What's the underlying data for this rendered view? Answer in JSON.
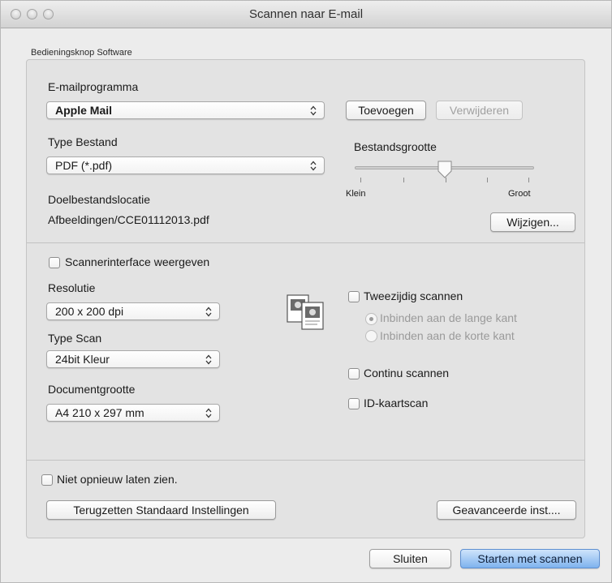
{
  "window": {
    "title": "Scannen naar E-mail"
  },
  "group": {
    "legend": "Bedieningsknop Software"
  },
  "email": {
    "label": "E-mailprogramma",
    "value": "Apple Mail",
    "add_button": "Toevoegen",
    "remove_button": "Verwijderen"
  },
  "file_type": {
    "label": "Type Bestand",
    "value": "PDF (*.pdf)"
  },
  "file_size": {
    "label": "Bestandsgrootte",
    "min_label": "Klein",
    "max_label": "Groot",
    "level_fraction": 0.5,
    "ticks": 5
  },
  "destination": {
    "label": "Doelbestandslocatie",
    "path": "Afbeeldingen/CCE01112013.pdf",
    "change_button": "Wijzigen..."
  },
  "scanner_interface": {
    "label": "Scannerinterface weergeven",
    "checked": false
  },
  "resolution": {
    "label": "Resolutie",
    "value": "200 x 200 dpi"
  },
  "scan_type": {
    "label": "Type Scan",
    "value": "24bit Kleur"
  },
  "document_size": {
    "label": "Documentgrootte",
    "value": "A4 210 x 297 mm"
  },
  "duplex": {
    "label": "Tweezijdig scannen",
    "checked": false,
    "long_edge": "Inbinden aan de lange kant",
    "short_edge": "Inbinden aan de korte kant",
    "selected": "long_edge"
  },
  "continuous": {
    "label": "Continu scannen",
    "checked": false
  },
  "id_card": {
    "label": "ID-kaartscan",
    "checked": false
  },
  "dont_show": {
    "label": "Niet opnieuw laten zien.",
    "checked": false
  },
  "buttons": {
    "reset": "Terugzetten Standaard Instellingen",
    "advanced": "Geavanceerde inst....",
    "close": "Sluiten",
    "start": "Starten met scannen"
  },
  "icons": {
    "popup_arrows": "updown-chevrons-icon",
    "duplex_preview": "duplex-pages-icon"
  }
}
